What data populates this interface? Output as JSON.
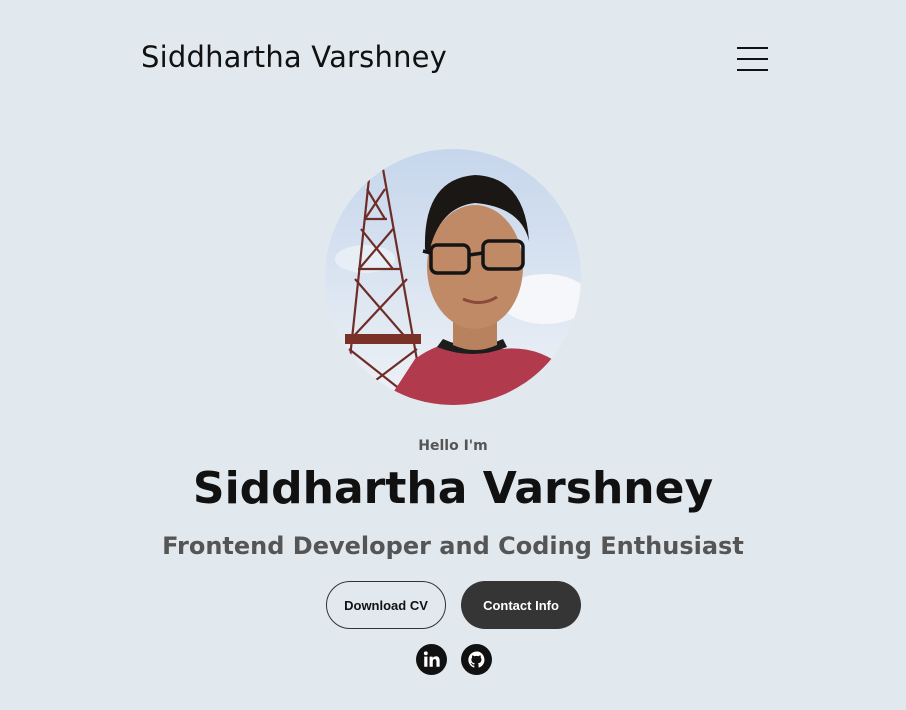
{
  "header": {
    "logo_text": "Siddhartha Varshney",
    "menu_icon": "hamburger-menu-icon"
  },
  "hero": {
    "greeting": "Hello I'm",
    "name": "Siddhartha Varshney",
    "role": "Frontend Developer and Coding Enthusiast",
    "photo_description": "profile-photo"
  },
  "buttons": {
    "download_cv": "Download CV",
    "contact_info": "Contact Info"
  },
  "social": {
    "linkedin_icon": "linkedin-icon",
    "github_icon": "github-icon"
  },
  "colors": {
    "background": "#e1e9ee",
    "text_primary": "#111111",
    "text_secondary": "#555555",
    "button_dark": "#353535"
  }
}
